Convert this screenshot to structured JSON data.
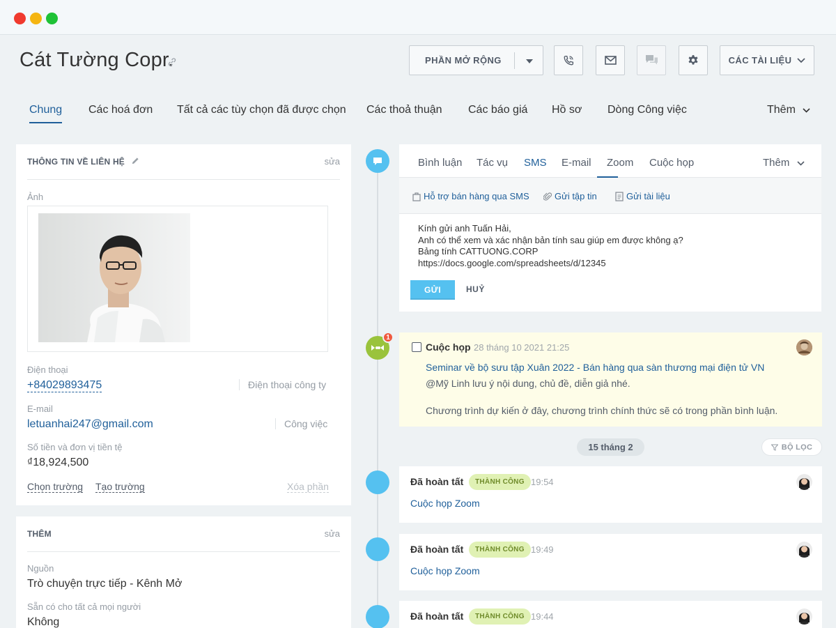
{
  "window": {
    "controls": [
      "close",
      "minimize",
      "maximize"
    ]
  },
  "header": {
    "title": "Cát Tường  Copr.",
    "extensions_label": "PHẦN MỞ RỘNG",
    "documents_label": "CÁC TÀI LIỆU"
  },
  "tabs": [
    {
      "label": "Chung"
    },
    {
      "label": "Các hoá đơn"
    },
    {
      "label": "Tất cả các tùy chọn đã được chọn"
    },
    {
      "label": "Các thoả thuận"
    },
    {
      "label": "Các báo giá"
    },
    {
      "label": "Hồ sơ"
    },
    {
      "label": "Dòng Công việc"
    },
    {
      "label": "Thêm"
    }
  ],
  "contact": {
    "heading": "THÔNG TIN VỀ LIÊN HỆ",
    "edit": "sửa",
    "photo_label": "Ảnh",
    "phone_label": "Điện thoại",
    "phone": "+84029893475",
    "phone_type": "Điện thoại công ty",
    "email_label": "E-mail",
    "email": "letuanhai247@gmail.com",
    "email_type": "Công việc",
    "amount_label": "Số tiền và đơn vị tiền tệ",
    "amount": "₫18,924,500",
    "choose_field": "Chọn trường",
    "create_field": "Tạo trường",
    "delete_section": "Xóa phần"
  },
  "more": {
    "heading": "THÊM",
    "edit": "sửa",
    "source_label": "Nguồn",
    "source": "Trò chuyện trực tiếp - Kênh Mở",
    "available_label": "Sẵn có cho tất cả mọi người",
    "available": "Không"
  },
  "composer": {
    "tabs": [
      "Bình luận",
      "Tác vụ",
      "SMS",
      "E-mail",
      "Zoom",
      "Cuộc họp",
      "Thêm"
    ],
    "tools": [
      "Hỗ trợ bán hàng qua SMS",
      "Gửi tập tin",
      "Gửi tài liệu"
    ],
    "lines": [
      "Kính gửi anh Tuấn Hải,",
      "Anh có thể xem và xác nhận bản tính sau giúp em được không ạ?",
      "Bảng tính CATTUONG.CORP",
      "https://docs.google.com/spreadsheets/d/12345"
    ],
    "send": "GỬI",
    "cancel": "HUỶ"
  },
  "meeting": {
    "badge_count": "1",
    "title": "Cuộc họp",
    "date": "28 tháng 10 2021 21:25",
    "link": "Seminar về bộ sưu tập Xuân 2022 - Bán hàng qua sàn thương mại điện tử VN",
    "note": "@Mỹ Linh lưu ý nội dung, chủ đề, diễn giả nhé.",
    "desc": "Chương trình dự kiến ở đây, chương trình chính thức sẽ có trong phần bình luận."
  },
  "separator": {
    "date": "15 tháng 2",
    "filter": "BỘ LỌC"
  },
  "activities": [
    {
      "title": "Đã hoàn tất",
      "status": "THÀNH CÔNG",
      "time": "19:54",
      "link": "Cuộc họp Zoom"
    },
    {
      "title": "Đã hoàn tất",
      "status": "THÀNH CÔNG",
      "time": "19:49",
      "link": "Cuộc họp Zoom"
    },
    {
      "title": "Đã hoàn tất",
      "status": "THÀNH CÔNG",
      "time": "19:44",
      "link": ""
    }
  ],
  "colors": {
    "accent": "#1f5f9a",
    "timeline": "#55c1f0",
    "meeting": "#9ac33c",
    "success_bg": "#e0f1b4",
    "meeting_bg": "#fefde8"
  }
}
